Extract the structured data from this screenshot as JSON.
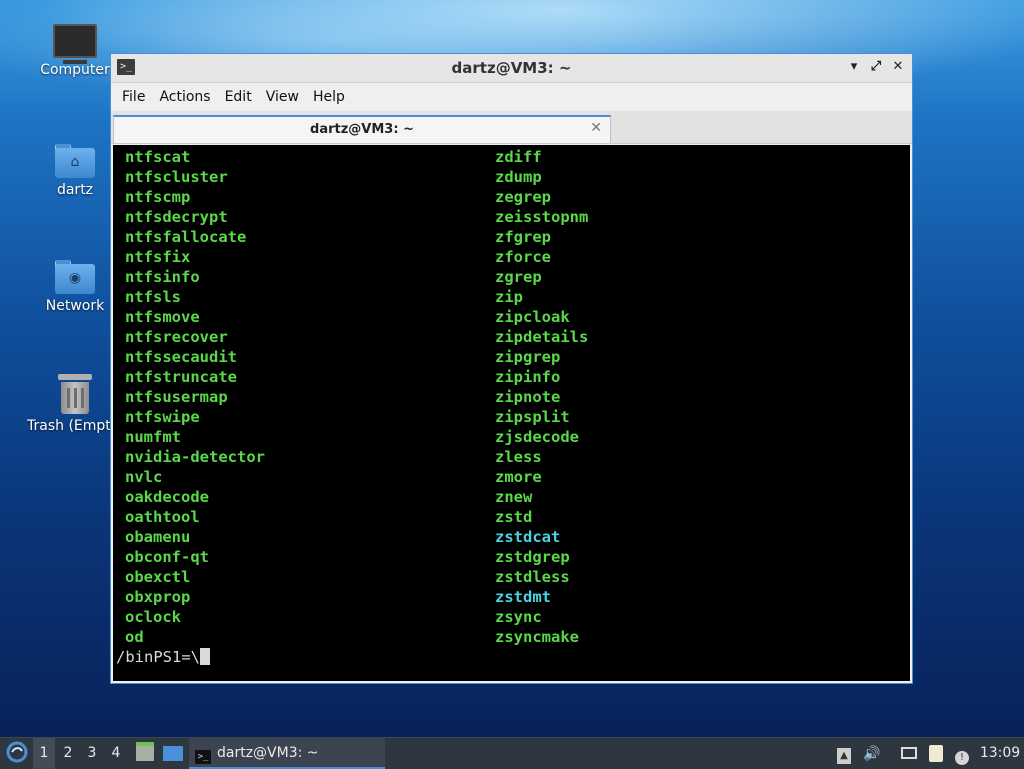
{
  "desktop": {
    "icons": [
      {
        "label": "Computer"
      },
      {
        "label": "dartz"
      },
      {
        "label": "Network"
      },
      {
        "label": "Trash (Empty)"
      }
    ]
  },
  "window": {
    "title": "dartz@VM3: ~",
    "menu": [
      "File",
      "Actions",
      "Edit",
      "View",
      "Help"
    ],
    "tab_label": "dartz@VM3: ~",
    "buttons": {
      "minimize": "▾",
      "maximize": "⤢",
      "close": "✕"
    },
    "terminal": {
      "left_column": [
        "ntfscat",
        "ntfscluster",
        "ntfscmp",
        "ntfsdecrypt",
        "ntfsfallocate",
        "ntfsfix",
        "ntfsinfo",
        "ntfsls",
        "ntfsmove",
        "ntfsrecover",
        "ntfssecaudit",
        "ntfstruncate",
        "ntfsusermap",
        "ntfswipe",
        "numfmt",
        "nvidia-detector",
        "nvlc",
        "oakdecode",
        "oathtool",
        "obamenu",
        "obconf-qt",
        "obexctl",
        "obxprop",
        "oclock",
        "od"
      ],
      "right_column": [
        "zdiff",
        "zdump",
        "zegrep",
        "zeisstopnm",
        "zfgrep",
        "zforce",
        "zgrep",
        "zip",
        "zipcloak",
        "zipdetails",
        "zipgrep",
        "zipinfo",
        "zipnote",
        "zipsplit",
        "zjsdecode",
        "zless",
        "zmore",
        "znew",
        "zstd",
        "zstdcat",
        "zstdgrep",
        "zstdless",
        "zstdmt",
        "zsync",
        "zsyncmake"
      ],
      "cyan_entries": [
        "zstdcat",
        "zstdmt"
      ],
      "prompt": "/binPS1=\\"
    }
  },
  "taskbar": {
    "desktops": [
      "1",
      "2",
      "3",
      "4"
    ],
    "active_desktop": "1",
    "window_button": "dartz@VM3: ~",
    "clock": "13:09"
  },
  "colors": {
    "accent": "#4a90d9",
    "terminal_green": "#5ad84a",
    "terminal_cyan": "#4cd3e3"
  }
}
